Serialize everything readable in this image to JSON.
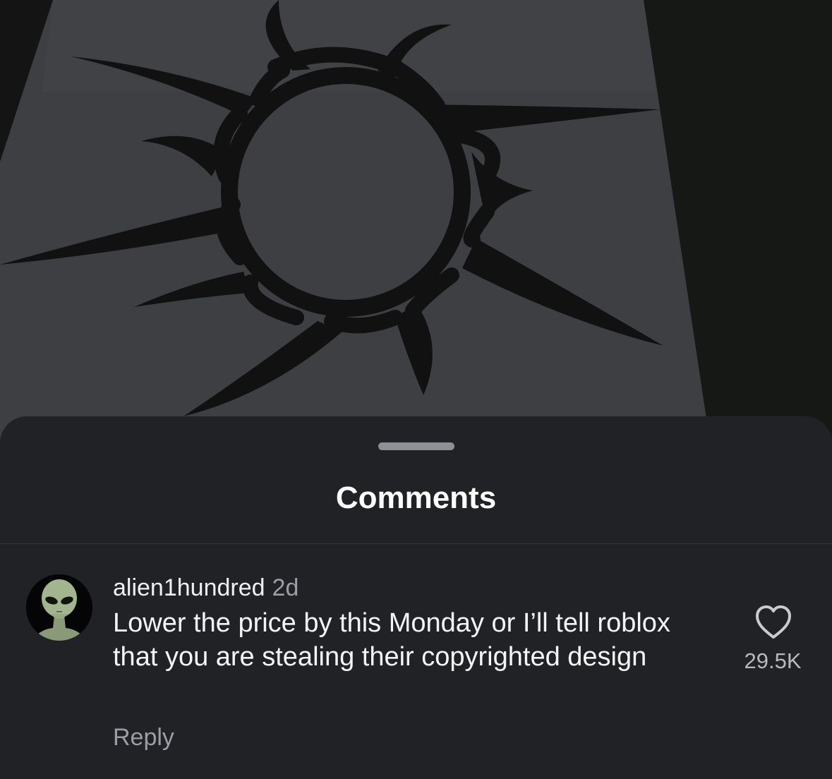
{
  "sheet": {
    "title": "Comments"
  },
  "comment": {
    "username": "alien1hundred",
    "timestamp": "2d",
    "text": "Lower the price by this Monday or I’ll tell roblox that you are stealing their copyrighted design",
    "reply_label": "Reply",
    "like_count": "29.5K",
    "avatar": "alien-avatar",
    "like_icon": "heart-outline-icon"
  },
  "media": {
    "subject": "rug-with-dark-star-circle-design"
  },
  "colors": {
    "sheet_background": "#202226",
    "primary_text": "#f4f4f6",
    "secondary_text": "#9c9ea3",
    "rug": "#3f4043",
    "rug_pattern": "#121213",
    "floor": "#141514"
  }
}
